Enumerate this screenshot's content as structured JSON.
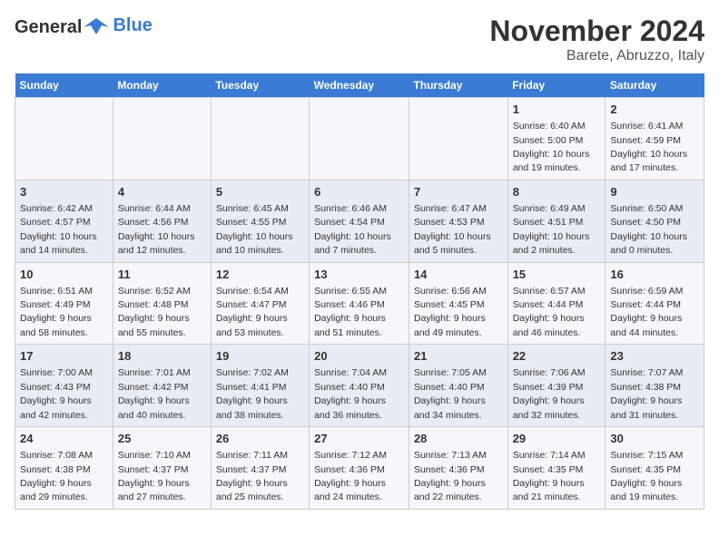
{
  "header": {
    "logo_general": "General",
    "logo_blue": "Blue",
    "month": "November 2024",
    "location": "Barete, Abruzzo, Italy"
  },
  "weekdays": [
    "Sunday",
    "Monday",
    "Tuesday",
    "Wednesday",
    "Thursday",
    "Friday",
    "Saturday"
  ],
  "weeks": [
    [
      {
        "day": "",
        "info": ""
      },
      {
        "day": "",
        "info": ""
      },
      {
        "day": "",
        "info": ""
      },
      {
        "day": "",
        "info": ""
      },
      {
        "day": "",
        "info": ""
      },
      {
        "day": "1",
        "info": "Sunrise: 6:40 AM\nSunset: 5:00 PM\nDaylight: 10 hours and 19 minutes."
      },
      {
        "day": "2",
        "info": "Sunrise: 6:41 AM\nSunset: 4:59 PM\nDaylight: 10 hours and 17 minutes."
      }
    ],
    [
      {
        "day": "3",
        "info": "Sunrise: 6:42 AM\nSunset: 4:57 PM\nDaylight: 10 hours and 14 minutes."
      },
      {
        "day": "4",
        "info": "Sunrise: 6:44 AM\nSunset: 4:56 PM\nDaylight: 10 hours and 12 minutes."
      },
      {
        "day": "5",
        "info": "Sunrise: 6:45 AM\nSunset: 4:55 PM\nDaylight: 10 hours and 10 minutes."
      },
      {
        "day": "6",
        "info": "Sunrise: 6:46 AM\nSunset: 4:54 PM\nDaylight: 10 hours and 7 minutes."
      },
      {
        "day": "7",
        "info": "Sunrise: 6:47 AM\nSunset: 4:53 PM\nDaylight: 10 hours and 5 minutes."
      },
      {
        "day": "8",
        "info": "Sunrise: 6:49 AM\nSunset: 4:51 PM\nDaylight: 10 hours and 2 minutes."
      },
      {
        "day": "9",
        "info": "Sunrise: 6:50 AM\nSunset: 4:50 PM\nDaylight: 10 hours and 0 minutes."
      }
    ],
    [
      {
        "day": "10",
        "info": "Sunrise: 6:51 AM\nSunset: 4:49 PM\nDaylight: 9 hours and 58 minutes."
      },
      {
        "day": "11",
        "info": "Sunrise: 6:52 AM\nSunset: 4:48 PM\nDaylight: 9 hours and 55 minutes."
      },
      {
        "day": "12",
        "info": "Sunrise: 6:54 AM\nSunset: 4:47 PM\nDaylight: 9 hours and 53 minutes."
      },
      {
        "day": "13",
        "info": "Sunrise: 6:55 AM\nSunset: 4:46 PM\nDaylight: 9 hours and 51 minutes."
      },
      {
        "day": "14",
        "info": "Sunrise: 6:56 AM\nSunset: 4:45 PM\nDaylight: 9 hours and 49 minutes."
      },
      {
        "day": "15",
        "info": "Sunrise: 6:57 AM\nSunset: 4:44 PM\nDaylight: 9 hours and 46 minutes."
      },
      {
        "day": "16",
        "info": "Sunrise: 6:59 AM\nSunset: 4:44 PM\nDaylight: 9 hours and 44 minutes."
      }
    ],
    [
      {
        "day": "17",
        "info": "Sunrise: 7:00 AM\nSunset: 4:43 PM\nDaylight: 9 hours and 42 minutes."
      },
      {
        "day": "18",
        "info": "Sunrise: 7:01 AM\nSunset: 4:42 PM\nDaylight: 9 hours and 40 minutes."
      },
      {
        "day": "19",
        "info": "Sunrise: 7:02 AM\nSunset: 4:41 PM\nDaylight: 9 hours and 38 minutes."
      },
      {
        "day": "20",
        "info": "Sunrise: 7:04 AM\nSunset: 4:40 PM\nDaylight: 9 hours and 36 minutes."
      },
      {
        "day": "21",
        "info": "Sunrise: 7:05 AM\nSunset: 4:40 PM\nDaylight: 9 hours and 34 minutes."
      },
      {
        "day": "22",
        "info": "Sunrise: 7:06 AM\nSunset: 4:39 PM\nDaylight: 9 hours and 32 minutes."
      },
      {
        "day": "23",
        "info": "Sunrise: 7:07 AM\nSunset: 4:38 PM\nDaylight: 9 hours and 31 minutes."
      }
    ],
    [
      {
        "day": "24",
        "info": "Sunrise: 7:08 AM\nSunset: 4:38 PM\nDaylight: 9 hours and 29 minutes."
      },
      {
        "day": "25",
        "info": "Sunrise: 7:10 AM\nSunset: 4:37 PM\nDaylight: 9 hours and 27 minutes."
      },
      {
        "day": "26",
        "info": "Sunrise: 7:11 AM\nSunset: 4:37 PM\nDaylight: 9 hours and 25 minutes."
      },
      {
        "day": "27",
        "info": "Sunrise: 7:12 AM\nSunset: 4:36 PM\nDaylight: 9 hours and 24 minutes."
      },
      {
        "day": "28",
        "info": "Sunrise: 7:13 AM\nSunset: 4:36 PM\nDaylight: 9 hours and 22 minutes."
      },
      {
        "day": "29",
        "info": "Sunrise: 7:14 AM\nSunset: 4:35 PM\nDaylight: 9 hours and 21 minutes."
      },
      {
        "day": "30",
        "info": "Sunrise: 7:15 AM\nSunset: 4:35 PM\nDaylight: 9 hours and 19 minutes."
      }
    ]
  ]
}
